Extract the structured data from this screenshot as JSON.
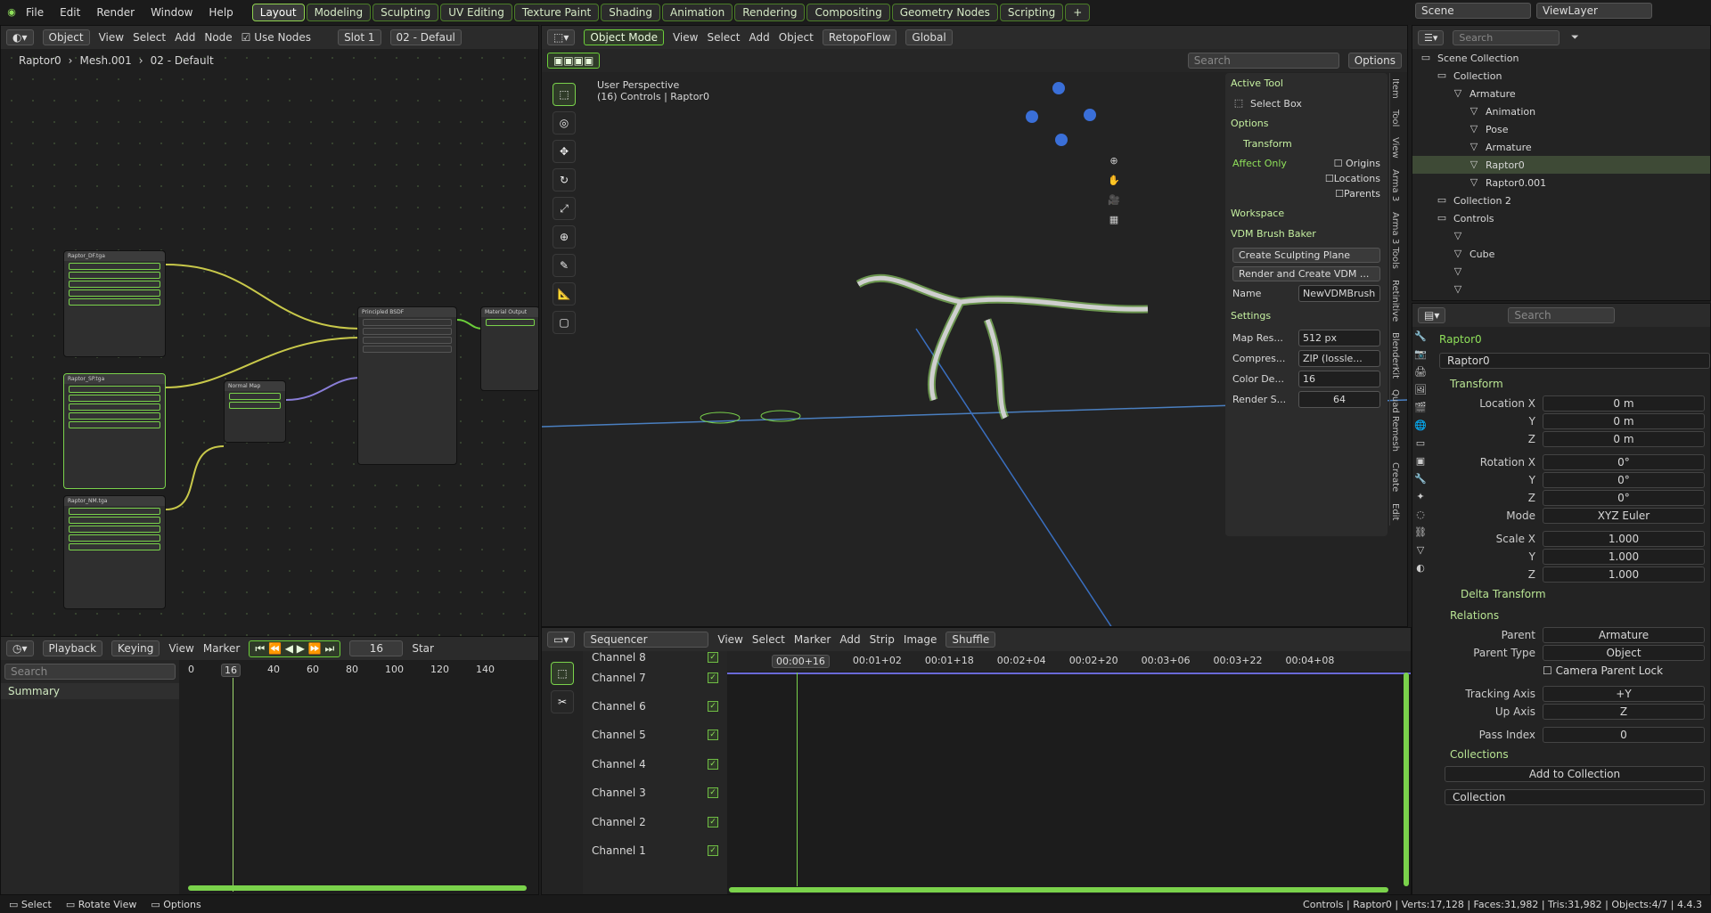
{
  "menu": [
    "File",
    "Edit",
    "Render",
    "Window",
    "Help"
  ],
  "workspaces": [
    "Layout",
    "Modeling",
    "Sculpting",
    "UV Editing",
    "Texture Paint",
    "Shading",
    "Animation",
    "Rendering",
    "Compositing",
    "Geometry Nodes",
    "Scripting"
  ],
  "scene": "Scene",
  "view_layer": "ViewLayer",
  "search": "Search",
  "node_editor": {
    "object": "Object",
    "view": "View",
    "select": "Select",
    "add": "Add",
    "node": "Node",
    "use_nodes": "Use Nodes",
    "slot": "Slot 1",
    "material": "02 - Defaul",
    "breadcrumb": [
      "Raptor0",
      "Mesh.001",
      "02 - Default"
    ],
    "nodes": [
      {
        "title": "Raptor_DF.tga"
      },
      {
        "title": "Raptor_SP.tga"
      },
      {
        "title": "Raptor_NM.tga"
      },
      {
        "title": "Normal Map"
      },
      {
        "title": "Principled BSDF"
      },
      {
        "title": "Material Output"
      }
    ]
  },
  "viewport": {
    "mode": "Object Mode",
    "view": "View",
    "select": "Select",
    "add": "Add",
    "object": "Object",
    "retopo": "RetopoFlow",
    "orientation": "Global",
    "options": "Options",
    "persp": "User Perspective",
    "info": "(16) Controls | Raptor0"
  },
  "tool_panel": {
    "active_tool": "Active Tool",
    "select_box": "Select Box",
    "options": "Options",
    "transform": "Transform",
    "affect_only": "Affect Only",
    "origins": "Origins",
    "locations": "Locations",
    "parents": "Parents",
    "workspace": "Workspace",
    "vdm": "VDM Brush Baker",
    "create_plane": "Create Sculpting Plane",
    "render_create": "Render and Create VDM ...",
    "name_label": "Name",
    "name_val": "NewVDMBrush",
    "settings": "Settings",
    "map_res_l": "Map Res...",
    "map_res_v": "512 px",
    "comp_l": "Compres...",
    "comp_v": "ZIP (lossle...",
    "color_l": "Color De...",
    "color_v": "16",
    "rs_l": "Render S...",
    "rs_v": "64"
  },
  "vtabs": [
    "Item",
    "Tool",
    "View",
    "Arma 3",
    "Arma 3 Tools",
    "Retinitive",
    "BlenderKit",
    "Quad Remesh",
    "Create",
    "Edit"
  ],
  "outliner": [
    {
      "t": "Scene Collection",
      "d": 0
    },
    {
      "t": "Collection",
      "d": 1
    },
    {
      "t": "Armature",
      "d": 2
    },
    {
      "t": "Animation",
      "d": 3
    },
    {
      "t": "Pose",
      "d": 3
    },
    {
      "t": "Armature",
      "d": 3
    },
    {
      "t": "Raptor0",
      "d": 3,
      "sel": true
    },
    {
      "t": "Raptor0.001",
      "d": 3
    },
    {
      "t": "Collection 2",
      "d": 1
    },
    {
      "t": "Controls",
      "d": 1
    },
    {
      "t": "",
      "d": 2
    },
    {
      "t": "Cube",
      "d": 2
    },
    {
      "t": "",
      "d": 2
    },
    {
      "t": "",
      "d": 2
    }
  ],
  "props": {
    "object": "Raptor0",
    "data": "Raptor0",
    "transform": "Transform",
    "loc": [
      "Location X",
      "Y",
      "Z"
    ],
    "locv": [
      "0 m",
      "0 m",
      "0 m"
    ],
    "rot": [
      "Rotation X",
      "Y",
      "Z"
    ],
    "rotv": [
      "0°",
      "0°",
      "0°"
    ],
    "mode_l": "Mode",
    "mode_v": "XYZ Euler",
    "scale": [
      "Scale X",
      "Y",
      "Z"
    ],
    "scalev": [
      "1.000",
      "1.000",
      "1.000"
    ],
    "delta": "Delta Transform",
    "relations": "Relations",
    "parent_l": "Parent",
    "parent_v": "Armature",
    "ptype_l": "Parent Type",
    "ptype_v": "Object",
    "cam_lock": "Camera Parent Lock",
    "track_l": "Tracking Axis",
    "track_v": "+Y",
    "up_l": "Up Axis",
    "up_v": "Z",
    "pass_l": "Pass Index",
    "pass_v": "0",
    "collections": "Collections",
    "add_coll": "Add to Collection",
    "coll_v": "Collection"
  },
  "timeline": {
    "playback": "Playback",
    "keying": "Keying",
    "view": "View",
    "marker": "Marker",
    "frame": "16",
    "start": "Star",
    "summary": "Summary",
    "ticks": [
      "0",
      "40",
      "60",
      "80",
      "100",
      "120",
      "140"
    ]
  },
  "sequencer": {
    "title": "Sequencer",
    "view": "View",
    "select": "Select",
    "marker": "Marker",
    "add": "Add",
    "strip": "Strip",
    "image": "Image",
    "shuffle": "Shuffle",
    "current": "00:00+16",
    "times": [
      "00:01+02",
      "00:01+18",
      "00:02+04",
      "00:02+20",
      "00:03+06",
      "00:03+22",
      "00:04+08"
    ],
    "channels": [
      "Channel 8",
      "Channel 7",
      "Channel 6",
      "Channel 5",
      "Channel 4",
      "Channel 3",
      "Channel 2",
      "Channel 1"
    ]
  },
  "status": {
    "select": "Select",
    "rotate": "Rotate View",
    "options": "Options",
    "stats": "Controls | Raptor0 | Verts:17,128 | Faces:31,982 | Tris:31,982 | Objects:4/7 | 4.4.3"
  }
}
